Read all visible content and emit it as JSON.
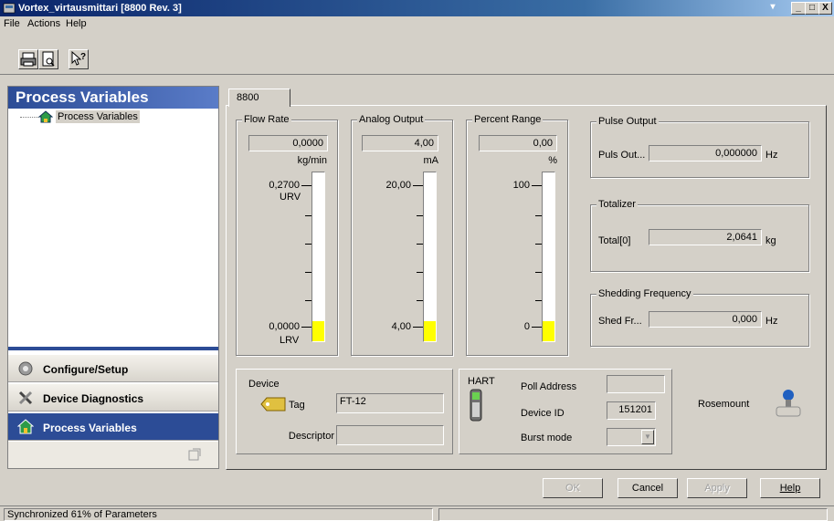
{
  "window": {
    "title": "Vortex_virtausmittari [8800 Rev. 3]",
    "min": "_",
    "max": "□",
    "close": "X",
    "restore": "▾"
  },
  "menu": [
    "File",
    "Actions",
    "Help"
  ],
  "nav": {
    "header": "Process Variables",
    "tree_item": "Process Variables",
    "buttons": [
      "Configure/Setup",
      "Device Diagnostics",
      "Process Variables"
    ]
  },
  "tab": "8800",
  "flow_rate": {
    "label": "Flow Rate",
    "value": "0,0000",
    "unit": "kg/min",
    "top": "0,2700",
    "top_sub": "URV",
    "bottom": "0,0000",
    "bottom_sub": "LRV",
    "fill": 0.12
  },
  "analog_output": {
    "label": "Analog Output",
    "value": "4,00",
    "unit": "mA",
    "top": "20,00",
    "bottom": "4,00",
    "fill": 0.12
  },
  "percent_range": {
    "label": "Percent Range",
    "value": "0,00",
    "unit": "%",
    "top": "100",
    "bottom": "0",
    "fill": 0.12
  },
  "pulse_output": {
    "label": "Pulse Output",
    "field": "Puls Out...",
    "value": "0,000000",
    "unit": "Hz"
  },
  "totalizer": {
    "label": "Totalizer",
    "field": "Total[0]",
    "value": "2,0641",
    "unit": "kg"
  },
  "shedding": {
    "label": "Shedding Frequency",
    "field": "Shed Fr...",
    "value": "0,000",
    "unit": "Hz"
  },
  "device": {
    "label": "Device",
    "tag_label": "Tag",
    "tag_value": "FT-12",
    "descriptor_label": "Descriptor",
    "descriptor_value": ""
  },
  "hart": {
    "label": "HART",
    "poll_label": "Poll Address",
    "poll_value": "",
    "id_label": "Device ID",
    "id_value": "151201",
    "burst_label": "Burst mode",
    "burst_value": ""
  },
  "brand": "Rosemount",
  "buttons": {
    "ok": "OK",
    "cancel": "Cancel",
    "apply": "Apply",
    "help": "Help"
  },
  "status": "Synchronized 61% of Parameters",
  "colors": {
    "title": "#0a246a",
    "nav_header": "#2c4c96",
    "gauge_fill": "#ffff00"
  }
}
